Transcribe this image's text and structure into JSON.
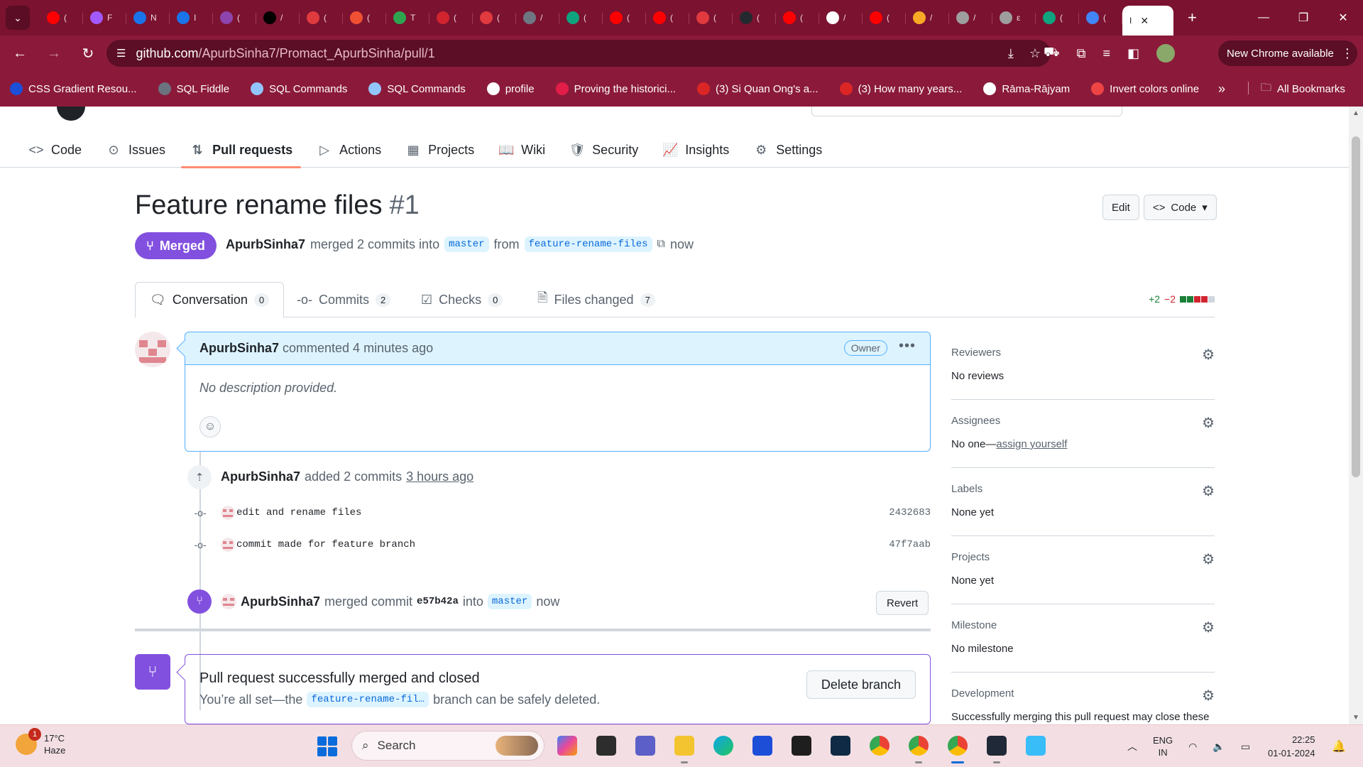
{
  "browser": {
    "tabs": [
      {
        "label": "(",
        "color": "#ff0000"
      },
      {
        "label": "F",
        "color": "#a259ff"
      },
      {
        "label": "N",
        "color": "#1a73e8"
      },
      {
        "label": "I",
        "color": "#1a73e8"
      },
      {
        "label": "(",
        "color": "#8e44ad"
      },
      {
        "label": "/",
        "color": "#000000"
      },
      {
        "label": "(",
        "color": "#e03a3e"
      },
      {
        "label": "(",
        "color": "#f05032"
      },
      {
        "label": "T",
        "color": "#2ea44f"
      },
      {
        "label": "(",
        "color": "#d1242f"
      },
      {
        "label": "(",
        "color": "#e03a3e"
      },
      {
        "label": "/",
        "color": "#6e7781"
      },
      {
        "label": "(",
        "color": "#10a37f"
      },
      {
        "label": "(",
        "color": "#ff0000"
      },
      {
        "label": "(",
        "color": "#ff0000"
      },
      {
        "label": "(",
        "color": "#e03a3e"
      },
      {
        "label": "(",
        "color": "#24292f"
      },
      {
        "label": "(",
        "color": "#ff0000"
      },
      {
        "label": "/",
        "color": "#ffffff"
      },
      {
        "label": "(",
        "color": "#ff0000"
      },
      {
        "label": "/",
        "color": "#f9a825"
      },
      {
        "label": "/",
        "color": "#9e9e9e"
      },
      {
        "label": "ε",
        "color": "#9e9e9e"
      },
      {
        "label": "(",
        "color": "#10a37f"
      },
      {
        "label": "(",
        "color": "#4285f4"
      }
    ],
    "active_tab": {
      "label": "I",
      "close": "✕"
    },
    "new_tab": "+",
    "url_host": "github.com",
    "url_path": "/ApurbSinha7/Promact_ApurbSinha/pull/1",
    "new_chrome_label": "New Chrome available",
    "bookmarks": [
      {
        "label": "CSS Gradient Resou...",
        "color": "#1d4ed8"
      },
      {
        "label": "SQL Fiddle",
        "color": "#6b7280"
      },
      {
        "label": "SQL Commands",
        "color": "#93c5fd"
      },
      {
        "label": "SQL Commands",
        "color": "#93c5fd"
      },
      {
        "label": "profile",
        "color": "#ffffff"
      },
      {
        "label": "Proving the historici...",
        "color": "#e11d48"
      },
      {
        "label": "(3) Si Quan Ong's a...",
        "color": "#dc2626"
      },
      {
        "label": "(3) How many years...",
        "color": "#dc2626"
      },
      {
        "label": "Rāma-Rājyam",
        "color": "#ffffff"
      },
      {
        "label": "Invert colors online",
        "color": "#ef4444"
      }
    ],
    "all_bookmarks": "All Bookmarks"
  },
  "repo_nav": [
    {
      "label": "Code",
      "icon": "<>"
    },
    {
      "label": "Issues",
      "icon": "⊙"
    },
    {
      "label": "Pull requests",
      "icon": "⇅"
    },
    {
      "label": "Actions",
      "icon": "▷"
    },
    {
      "label": "Projects",
      "icon": "▦"
    },
    {
      "label": "Wiki",
      "icon": "📖"
    },
    {
      "label": "Security",
      "icon": "🛡"
    },
    {
      "label": "Insights",
      "icon": "📈"
    },
    {
      "label": "Settings",
      "icon": "⚙"
    }
  ],
  "pr": {
    "title": "Feature rename files",
    "number": "#1",
    "edit_label": "Edit",
    "code_label": "Code",
    "status": "Merged",
    "author": "ApurbSinha7",
    "meta_verb": "merged 2 commits into",
    "base_branch": "master",
    "from_word": "from",
    "head_branch": "feature-rename-files",
    "when": "now"
  },
  "tabs": [
    {
      "label": "Conversation",
      "count": "0"
    },
    {
      "label": "Commits",
      "count": "2"
    },
    {
      "label": "Checks",
      "count": "0"
    },
    {
      "label": "Files changed",
      "count": "7"
    }
  ],
  "diffstat": {
    "additions": "+2",
    "deletions": "−2"
  },
  "comment": {
    "author": "ApurbSinha7",
    "action": "commented 4 minutes ago",
    "badge": "Owner",
    "body": "No description provided."
  },
  "commits_event": {
    "author": "ApurbSinha7",
    "action": "added 2 commits",
    "time": "3 hours ago",
    "commits": [
      {
        "message": "edit and rename files",
        "sha": "2432683"
      },
      {
        "message": "commit made for feature branch",
        "sha": "47f7aab"
      }
    ]
  },
  "merge_event": {
    "author": "ApurbSinha7",
    "action": "merged commit",
    "sha": "e57b42a",
    "into": "into",
    "branch": "master",
    "when": "now",
    "revert_label": "Revert"
  },
  "merged_box": {
    "title": "Pull request successfully merged and closed",
    "prefix": "You’re all set—the",
    "branch": "feature-rename-fil…",
    "suffix": "branch can be safely deleted.",
    "delete_label": "Delete branch"
  },
  "sidebar": [
    {
      "title": "Reviewers",
      "value": "No reviews"
    },
    {
      "title": "Assignees",
      "value": "No one—",
      "link": "assign yourself"
    },
    {
      "title": "Labels",
      "value": "None yet"
    },
    {
      "title": "Projects",
      "value": "None yet"
    },
    {
      "title": "Milestone",
      "value": "No milestone"
    },
    {
      "title": "Development",
      "value": "Successfully merging this pull request may close these"
    }
  ],
  "taskbar": {
    "temp": "17°C",
    "condition": "Haze",
    "notif_count": "1",
    "search_label": "Search",
    "lang1": "ENG",
    "lang2": "IN",
    "time": "22:25",
    "date": "01-01-2024"
  },
  "colors": {
    "accent_merged": "#8250df",
    "chrome_frame": "#8b1a3a",
    "link": "#0969da"
  }
}
